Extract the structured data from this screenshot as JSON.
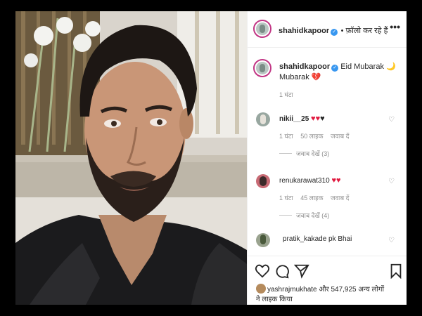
{
  "post": {
    "username": "shahidkapoor",
    "verified_mark": "✓",
    "header_text": "• फ़ॉलो कर रहे हैं",
    "more_icon": "more-options-icon",
    "caption_text": "Eid Mubarak 🌙",
    "caption_line2": "Mubarak 💔",
    "caption_time": "1 घंटा"
  },
  "comments": [
    {
      "username": "nikii__25",
      "text": "♥♥",
      "extra": "♥",
      "time": "1 घंटा",
      "likes": "50 लाइक",
      "reply": "जवाब दें",
      "replies": "जवाब देखें (3)"
    },
    {
      "username": "renukarawat310",
      "text": "♥♥",
      "extra": "",
      "time": "1 घंटा",
      "likes": "45 लाइक",
      "reply": "जवाब दें",
      "replies": "जवाब देखें (4)"
    },
    {
      "username": "pratik_kakade",
      "text": "pk Bhai",
      "extra": "",
      "time": "",
      "likes": "",
      "reply": "",
      "replies": ""
    }
  ],
  "likes": {
    "line1": "yashrajmukhate और 547,925 अन्य लोगों",
    "line2": "ने लाइक किया"
  },
  "colors": {
    "accent_heart": "#e0173d",
    "verified": "#3897f0",
    "muted": "#8e8e8e",
    "story_ring": "#c13584"
  }
}
